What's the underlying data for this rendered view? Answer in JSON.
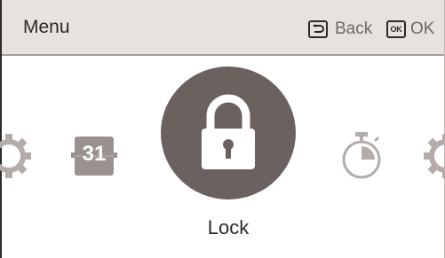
{
  "header": {
    "title": "Menu",
    "back": {
      "icon": "back-arrow-icon",
      "label": "Back"
    },
    "ok": {
      "icon": "ok-key-icon",
      "icon_text": "OK",
      "label": "OK"
    }
  },
  "carousel": {
    "items": [
      {
        "id": "settings-left",
        "icon": "gear-icon"
      },
      {
        "id": "calendar",
        "icon": "calendar-icon",
        "text": "31"
      },
      {
        "id": "lock",
        "icon": "lock-icon",
        "label": "Lock",
        "selected": true
      },
      {
        "id": "timer",
        "icon": "stopwatch-icon"
      },
      {
        "id": "settings-right",
        "icon": "gear-icon"
      }
    ]
  },
  "colors": {
    "header_bg": "#e6e2e0",
    "selected_bg": "#6b625f",
    "inactive_icon": "#b3aca9",
    "text": "#2c2827"
  }
}
